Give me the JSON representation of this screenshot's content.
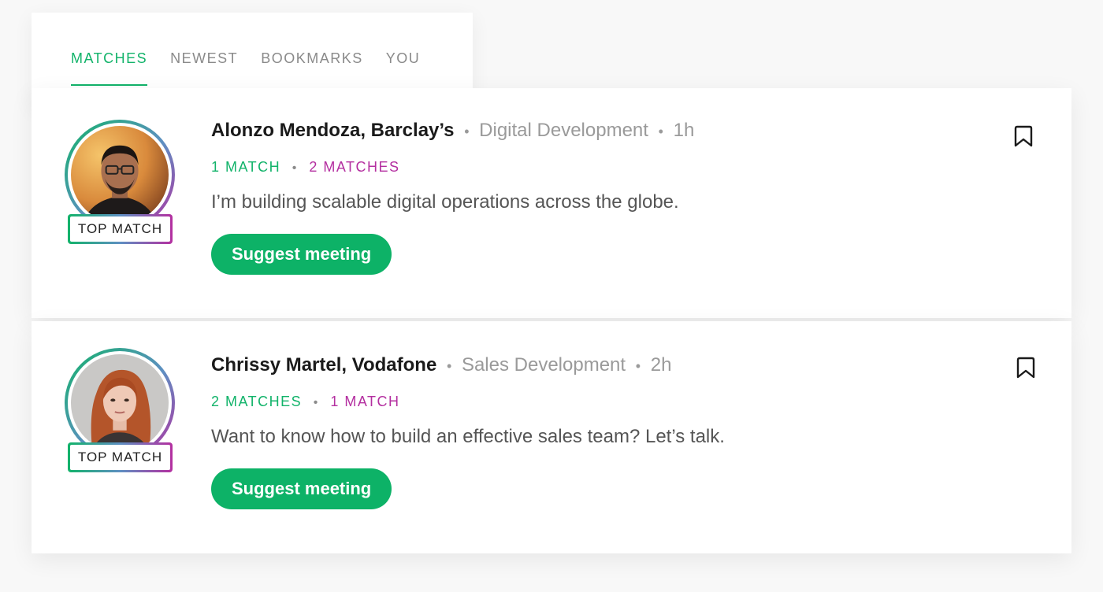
{
  "tabs": [
    {
      "label": "MATCHES",
      "active": true
    },
    {
      "label": "NEWEST",
      "active": false
    },
    {
      "label": "BOOKMARKS",
      "active": false
    },
    {
      "label": "YOU",
      "active": false
    }
  ],
  "colors": {
    "accent_green": "#12b36a",
    "accent_purple": "#b42fa0",
    "button_green": "#0db267"
  },
  "feed": [
    {
      "name": "Alonzo Mendoza, Barclay’s",
      "department": "Digital Development",
      "time": "1h",
      "separator": "•",
      "badge": "TOP MATCH",
      "match_green": "1 MATCH",
      "match_purple": "2 MATCHES",
      "message": "I’m building scalable digital operations across the globe.",
      "button_label": "Suggest meeting",
      "avatar_icon": "avatar-photo-man",
      "bookmark_icon": "bookmark-icon"
    },
    {
      "name": "Chrissy Martel, Vodafone",
      "department": "Sales Development",
      "time": "2h",
      "separator": "•",
      "badge": "TOP MATCH",
      "match_green": "2 MATCHES",
      "match_purple": "1 MATCH",
      "message": "Want to know how to build an effective sales team? Let’s talk.",
      "button_label": "Suggest meeting",
      "avatar_icon": "avatar-photo-woman",
      "bookmark_icon": "bookmark-icon"
    }
  ]
}
